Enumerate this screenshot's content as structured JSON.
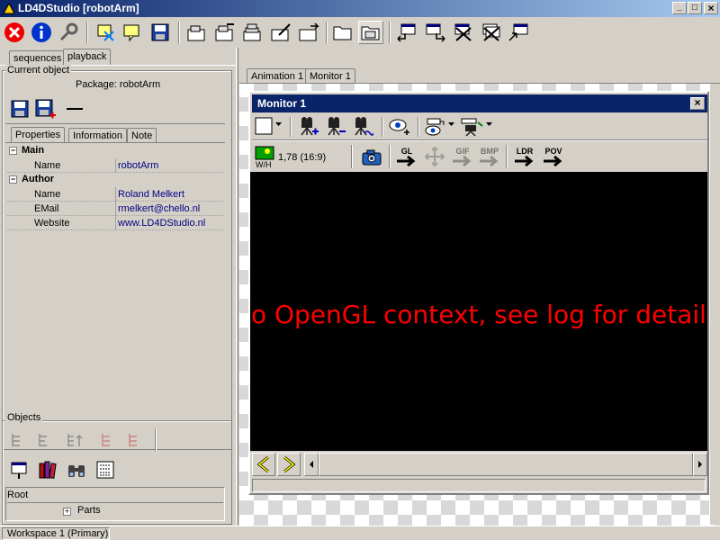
{
  "titlebar": {
    "title": "LD4DStudio [robotArm]"
  },
  "window_controls": {
    "minimize": "_",
    "maximize": "□",
    "close": "×"
  },
  "toolbar": {
    "close_icon": "x-circle-icon",
    "info_icon": "info-icon",
    "tools_icon": "wrench-icon"
  },
  "top_tabs": [
    "sequences",
    "playback"
  ],
  "current_object": {
    "legend": "Current object",
    "package": "Package: robotArm",
    "sub_tabs": [
      "Properties",
      "Information",
      "Note"
    ],
    "groups": [
      {
        "name": "Main",
        "rows": [
          {
            "key": "Name",
            "value": "robotArm"
          }
        ]
      },
      {
        "name": "Author",
        "rows": [
          {
            "key": "Name",
            "value": "Roland Melkert"
          },
          {
            "key": "EMail",
            "value": "rmelkert@chello.nl"
          },
          {
            "key": "Website",
            "value": "www.LD4DStudio.nl"
          }
        ]
      }
    ]
  },
  "objects": {
    "legend": "Objects",
    "root": "Root",
    "parts": "Parts",
    "expand": "+"
  },
  "doc_tabs": [
    "Animation 1",
    "Monitor 1"
  ],
  "monitor": {
    "title": "Monitor 1",
    "close": "×",
    "aspect": "1,78 (16:9)",
    "wh_label": "W/H",
    "gl_label": "GL",
    "gif_label": "GIF",
    "bmp_label": "BMP",
    "ldr_label": "LDR",
    "pov_label": "POV",
    "error_message": "No OpenGL context, see log for details",
    "error_color": "#ff0000"
  },
  "statusbar": {
    "workspace": "Workspace 1 (Primary)"
  },
  "colors": {
    "titlebar_start": "#0a246a",
    "titlebar_end": "#a6caf0",
    "link": "#000080"
  }
}
